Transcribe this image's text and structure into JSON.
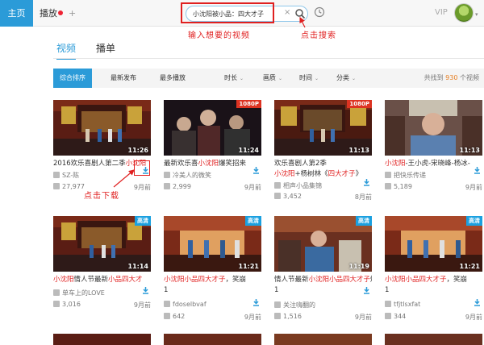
{
  "topbar": {
    "home_label": "主页",
    "play_label": "播放",
    "plus_label": "+",
    "search_value": "小沈阳被小品：四大才子",
    "search_clear": "×",
    "vip_label": "VIP",
    "avatar_caret": "▾"
  },
  "annotations": {
    "search_hint": "输入想要的视频",
    "click_search": "点击搜索",
    "click_download": "点击下载"
  },
  "section_tabs": [
    {
      "label": "视频",
      "active": true
    },
    {
      "label": "播单",
      "active": false
    }
  ],
  "filterbar": {
    "sort": [
      {
        "label": "综合排序",
        "active": true
      },
      {
        "label": "最新发布",
        "active": false
      },
      {
        "label": "最多播放",
        "active": false
      }
    ],
    "dropdowns": [
      {
        "label": "时长",
        "caret": "⌄"
      },
      {
        "label": "画质",
        "caret": "⌄"
      },
      {
        "label": "时间",
        "caret": "⌄"
      },
      {
        "label": "分类",
        "caret": "⌄"
      }
    ],
    "count_prefix": "共找到",
    "count_value": "930",
    "count_suffix": "个视频"
  },
  "videos": [
    {
      "duration": "11:26",
      "badge": "",
      "t1a": "2016欢乐喜剧人第二季",
      "t1b": "小沈阳",
      "t2a": "",
      "t2b": "",
      "t2c": "",
      "uploader": "SZ-陈",
      "plays": "27,977",
      "age": "9月前"
    },
    {
      "duration": "11:24",
      "badge": "1080P",
      "t1a": "最新欢乐喜",
      "t1b": "小沈阳",
      "t1c": "爆笑招来",
      "t2a": "",
      "t2b": "",
      "t2c": "",
      "uploader": "冷美人的微笑",
      "plays": "2,999",
      "age": "9月前"
    },
    {
      "duration": "11:13",
      "badge": "1080P",
      "t1a": "欢乐喜剧人第2季",
      "t1b": "",
      "t2a": "小沈阳",
      "t2b": "+杨树林《",
      "t2c": "四大才子",
      "t2d": "》",
      "uploader": "相声小品集锦",
      "plays": "3,452",
      "age": "8月前"
    },
    {
      "duration": "11:13",
      "badge": "",
      "t1a": "",
      "t1b": "小沈阳",
      "t1c": "-王小虎-宋晓峰-杨冰-",
      "t2a": "",
      "t2b": "",
      "t2c": "",
      "uploader": "把快乐传递",
      "plays": "5,189",
      "age": "9月前"
    },
    {
      "duration": "11:14",
      "badge": "高清",
      "t1a": "",
      "t1b": "小沈阳",
      "t1c": "情人节最新",
      "t1d": "小品四大才",
      "uploader": "单车上的LOVE",
      "plays": "3,016",
      "age": "9月前"
    },
    {
      "duration": "11:21",
      "badge": "高清",
      "t1a": "",
      "t1b": "小沈阳小品四大才子",
      "t1c": "，笑崩",
      "t2a": "1",
      "uploader": "fdoselbvaf",
      "plays": "642",
      "age": "9月前"
    },
    {
      "duration": "11:19",
      "badge": "高清",
      "t1a": "情人节最新",
      "t1b": "小沈阳小品四大才子",
      "t1c": "爆笑",
      "t2a": "1",
      "uploader": "关注嗨翻的",
      "plays": "1,516",
      "age": "9月前"
    },
    {
      "duration": "11:21",
      "badge": "高清",
      "t1a": "",
      "t1b": "小沈阳小品四大才子",
      "t1c": "，笑崩",
      "t2a": "1",
      "uploader": "tfjtlsxfat",
      "plays": "344",
      "age": "9月前"
    }
  ]
}
